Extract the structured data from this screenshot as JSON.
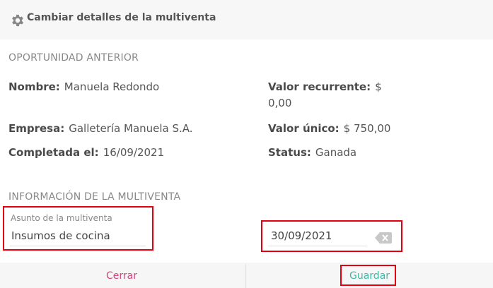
{
  "header": {
    "title": "Cambiar detalles de la multiventa",
    "icon": "gear-icon"
  },
  "previous": {
    "section_title": "OPORTUNIDAD ANTERIOR",
    "name_label": "Nombre:",
    "name_value": "Manuela Redondo",
    "recurring_label": "Valor recurrente:",
    "recurring_value_1": "$",
    "recurring_value_2": "0,00",
    "company_label": "Empresa:",
    "company_value": "Galletería Manuela S.A.",
    "unique_label": "Valor único:",
    "unique_value": "$ 750,00",
    "completed_label": "Completada el:",
    "completed_value": "16/09/2021",
    "status_label": "Status:",
    "status_value": "Ganada"
  },
  "multisale": {
    "section_title": "INFORMACIÓN DE LA MULTIVENTA",
    "subject_label": "Asunto de la multiventa",
    "subject_value": "Insumos de cocina",
    "date_value": "30/09/2021"
  },
  "footer": {
    "close_label": "Cerrar",
    "save_label": "Guardar"
  },
  "colors": {
    "highlight": "#e3000f",
    "close": "#d0477c",
    "save": "#3fb8a5"
  }
}
